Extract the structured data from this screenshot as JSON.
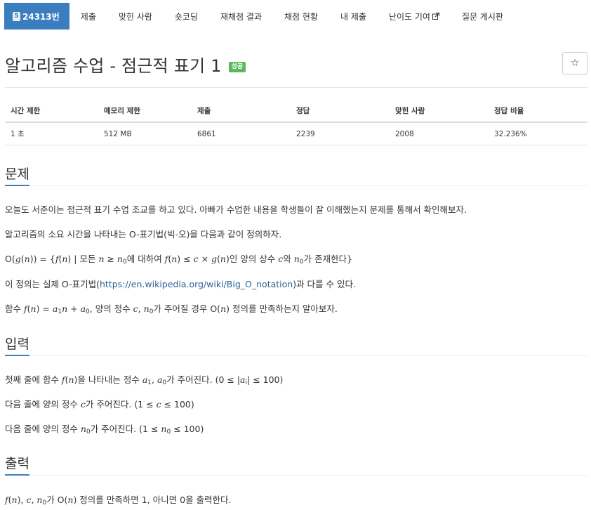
{
  "nav": {
    "problem_number": "24313번",
    "badge_digit": "5",
    "tabs": [
      "제출",
      "맞힌 사람",
      "숏코딩",
      "재채점 결과",
      "채점 현황",
      "내 제출",
      "난이도 기여",
      "질문 게시판"
    ]
  },
  "title": "알고리즘 수업 - 점근적 표기 1",
  "status_badge": "성공",
  "star_icon": "star-icon",
  "info": {
    "headers": [
      "시간 제한",
      "메모리 제한",
      "제출",
      "정답",
      "맞힌 사람",
      "정답 비율"
    ],
    "values": [
      "1 초",
      "512 MB",
      "6861",
      "2239",
      "2008",
      "32.236%"
    ]
  },
  "sections": {
    "problem": "문제",
    "input": "입력",
    "output": "출력"
  },
  "problem": {
    "p1": "오늘도 서준이는 점근적 표기 수업 조교를 하고 있다. 아빠가 수업한 내용을 학생들이 잘 이해했는지 문제를 통해서 확인해보자.",
    "p2": "알고리즘의 소요 시간을 나타내는 O-표기법(빅-오)을 다음과 같이 정의하자.",
    "p3": {
      "a": "O(",
      "g": "g",
      "b": "(",
      "n": "n",
      "c": ")) = {",
      "f": "f",
      "d": "(",
      "n2": "n",
      "e": ") | 모든 ",
      "n3": "n",
      "ge": " ≥ ",
      "n0": "n",
      "zero": "0",
      "mid": "에 대하여 ",
      "f2": "f",
      "lp": "(",
      "n4": "n",
      "rp": ") ≤ ",
      "c1": "c",
      "times": " × ",
      "g2": "g",
      "lp2": "(",
      "n5": "n",
      "rp2": ")인 양의 상수 ",
      "c2": "c",
      "wa": "와 ",
      "n6": "n",
      "zero2": "0",
      "tail": "가 존재한다}"
    },
    "p4": {
      "pre": "이 정의는 실제 O-표기법(",
      "link": "https://en.wikipedia.org/wiki/Big_O_notation",
      "post": ")과 다를 수 있다."
    },
    "p5": {
      "a": "함수 ",
      "f": "f",
      "b": "(",
      "n": "n",
      "c": ") = ",
      "a1": "a",
      "one": "1",
      "n2": "n",
      "plus": " + ",
      "a0": "a",
      "zero": "0",
      "d": ", 양의 정수 ",
      "cc": "c",
      "e": ", ",
      "n0": "n",
      "zero2": "0",
      "g": "가 주어질 경우 O(",
      "n3": "n",
      "h": ") 정의를 만족하는지 알아보자."
    }
  },
  "input": {
    "l1": {
      "a": "첫째 줄에 함수 ",
      "f": "f",
      "b": "(",
      "n": "n",
      "c": ")을 나타내는 정수 ",
      "a1": "a",
      "one": "1",
      "sep": ", ",
      "a0": "a",
      "zero": "0",
      "d": "가 주어진다. (0 ≤ |",
      "ai": "a",
      "i": "i",
      "e": "| ≤ 100)"
    },
    "l2": {
      "a": "다음 줄에 양의 정수 ",
      "c": "c",
      "b": "가 주어진다. (1 ≤ ",
      "c2": "c",
      "d": " ≤ 100)"
    },
    "l3": {
      "a": "다음 줄에 양의 정수 ",
      "n": "n",
      "zero": "0",
      "b": "가 주어진다. (1 ≤ ",
      "n2": "n",
      "zero2": "0",
      "d": " ≤ 100)"
    }
  },
  "output": {
    "l1": {
      "f": "f",
      "a": "(",
      "n": "n",
      "b": "), ",
      "c": "c",
      "sep": ", ",
      "n0": "n",
      "zero": "0",
      "d": "가 O(",
      "n2": "n",
      "e": ") 정의를 만족하면 1, 아니면 0을 출력한다."
    }
  },
  "colors": {
    "accent": "#3a7ebf",
    "success": "#5cb85c",
    "link": "#2a6496"
  }
}
